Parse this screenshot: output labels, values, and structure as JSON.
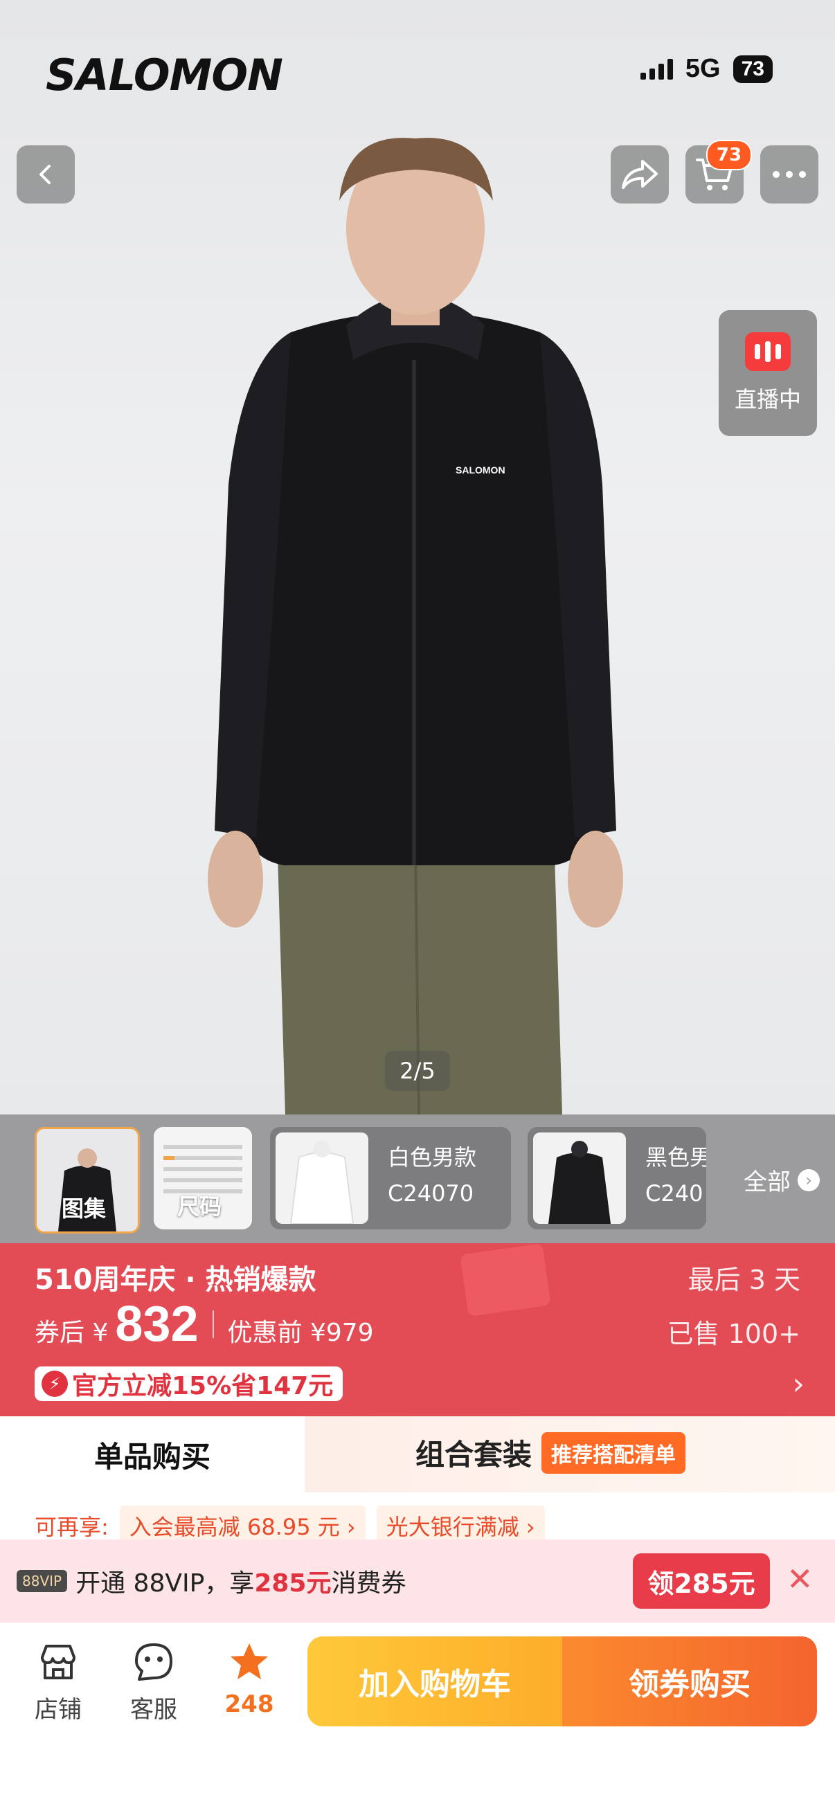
{
  "status_bar": {
    "signal": "5G",
    "battery": "73"
  },
  "brand": {
    "logo_text": "SALOMON"
  },
  "header": {
    "cart_count": "73"
  },
  "live": {
    "label": "直播中"
  },
  "gallery": {
    "page_indicator": "2/5"
  },
  "thumbnails": {
    "items": [
      {
        "label": "图集"
      },
      {
        "label": "尺码"
      }
    ],
    "skus": [
      {
        "name": "白色男款",
        "code": "C24070"
      },
      {
        "name": "黑色男",
        "code": "C240"
      }
    ],
    "see_all": "全部"
  },
  "promo": {
    "event_title": "510周年庆 · 热销爆款",
    "coupon_label": "券后 ¥",
    "price": "832",
    "original_label": "优惠前 ¥979",
    "discount_text": "官方立减15%省147元",
    "days_left": "最后 3 天",
    "sold": "已售 100+"
  },
  "tabs": {
    "single": "单品购买",
    "bundle": "组合套装",
    "recommend_badge": "推荐搭配清单"
  },
  "promo_strip": {
    "label": "可再享:",
    "tags": [
      "入会最高减 68.95 元 ›",
      "光大银行满减 ›"
    ]
  },
  "vip_banner": {
    "logo": "88VIP",
    "text_prefix": "开通 88VIP，享",
    "amount": "285元",
    "text_suffix": "消费券",
    "button": "领285元"
  },
  "bottom_bar": {
    "shop": "店铺",
    "service": "客服",
    "favorites": "248",
    "add_to_cart": "加入购物车",
    "buy_with_coupon": "领券购买"
  },
  "colors": {
    "promo_red": "#e34b55",
    "accent_orange": "#ff6a25",
    "cart_yellow": "#ffc83a",
    "buy_orange": "#f4642e"
  }
}
